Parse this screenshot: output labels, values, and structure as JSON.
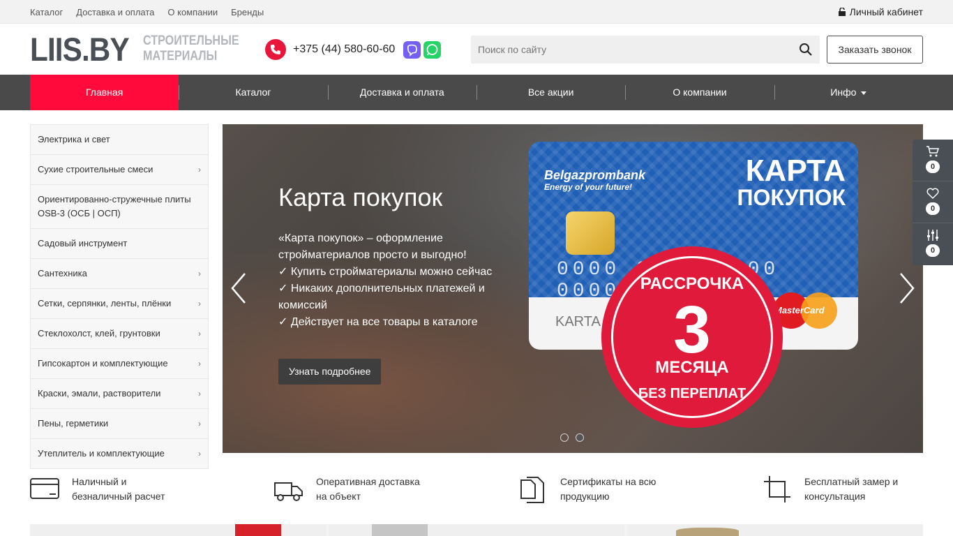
{
  "topbar": {
    "links": [
      "Каталог",
      "Доставка и оплата",
      "О компании",
      "Бренды"
    ],
    "cabinet": "Личный кабинет"
  },
  "header": {
    "logo": "LIIS.BY",
    "tagline_line1": "СТРОИТЕЛЬНЫЕ",
    "tagline_line2": "МАТЕРИАЛЫ",
    "phone": "+375 (44) 580-60-60",
    "search_placeholder": "Поиск по сайту",
    "callback": "Заказать звонок"
  },
  "nav": {
    "items": [
      "Главная",
      "Каталог",
      "Доставка и оплата",
      "Все акции",
      "О компании",
      "Инфо"
    ],
    "active_index": 0
  },
  "sidebar": {
    "categories": [
      {
        "label": "Электрика и свет",
        "has_children": false
      },
      {
        "label": "Сухие строительные смеси",
        "has_children": true
      },
      {
        "label": "Ориентированно-стружечные плиты OSB-3 (ОСБ | ОСП)",
        "has_children": false
      },
      {
        "label": "Садовый инструмент",
        "has_children": false
      },
      {
        "label": "Сантехника",
        "has_children": true
      },
      {
        "label": "Сетки, серпянки, ленты, плёнки",
        "has_children": true
      },
      {
        "label": "Стеклохолст, клей, грунтовки",
        "has_children": true
      },
      {
        "label": "Гипсокартон и комплектующие",
        "has_children": true
      },
      {
        "label": "Краски, эмали, растворители",
        "has_children": true
      },
      {
        "label": "Пены, герметики",
        "has_children": true
      },
      {
        "label": "Утеплитель и комплектующие",
        "has_children": true
      }
    ]
  },
  "slider": {
    "title": "Карта покупок",
    "text_lines": [
      "«Карта покупок» – оформление стройматериалов просто и выгодно!",
      "✓ Купить стройматериалы можно сейчас",
      "✓ Никаких дополнительных платежей и комиссий",
      "✓ Действует на все товары в каталоге"
    ],
    "button": "Узнать подробнее",
    "card": {
      "bank": "Belgazprombank",
      "motto": "Energy of your future!",
      "title_line1": "КАРТА",
      "title_line2": "ПОКУПОК",
      "numbers": "0000 0000 0000 0000",
      "name": "KARTA P",
      "brand": "MasterCard"
    },
    "badge": {
      "top": "РАССРОЧКА",
      "number": "3",
      "months": "МЕСЯЦА",
      "bottom": "БЕЗ ПЕРЕПЛАТ"
    },
    "active_slide": 1,
    "slide_count": 2
  },
  "widget": {
    "cart_count": "0",
    "favorites_count": "0",
    "compare_count": "0"
  },
  "features": [
    {
      "icon": "card-icon",
      "line1": "Наличный и",
      "line2": "безналичный расчет"
    },
    {
      "icon": "truck-icon",
      "line1": "Оперативная доставка",
      "line2": "на объект"
    },
    {
      "icon": "documents-icon",
      "line1": "Сертификаты на всю",
      "line2": "продукцию"
    },
    {
      "icon": "crop-icon",
      "line1": "Бесплатный замер и",
      "line2": "консультация"
    }
  ],
  "colors": {
    "accent": "#ff0a3b",
    "nav_bg": "#4a4a4a",
    "logo": "#4a4f56"
  }
}
